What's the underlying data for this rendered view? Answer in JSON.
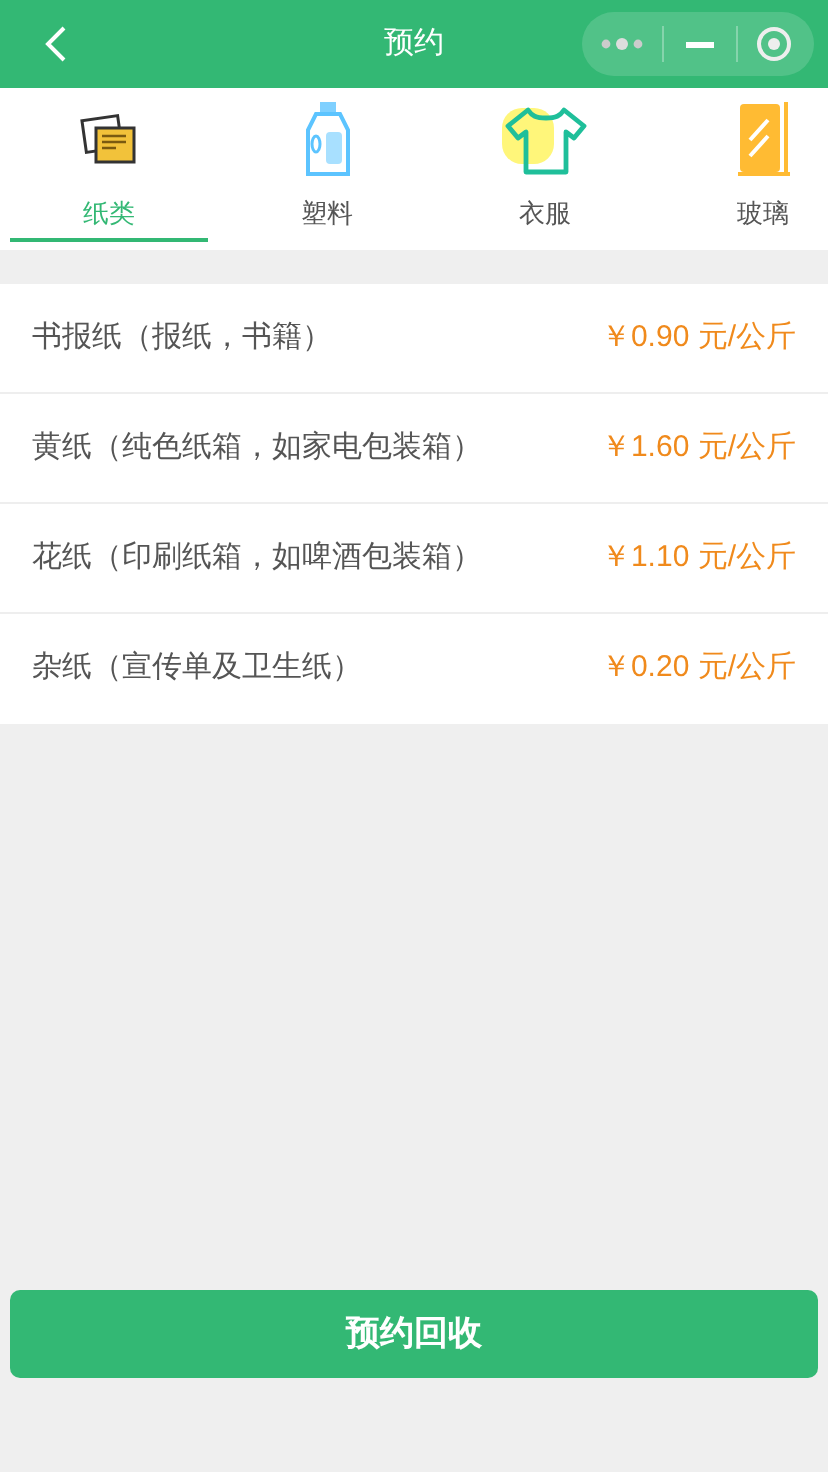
{
  "nav_bar": {
    "title": "预约"
  },
  "tabs": [
    {
      "label": "纸类",
      "kind": "paper",
      "selected": true
    },
    {
      "label": "塑料",
      "kind": "bottle",
      "selected": false
    },
    {
      "label": "衣服",
      "kind": "shirt",
      "selected": false
    },
    {
      "label": "玻璃",
      "kind": "glass",
      "selected": false
    }
  ],
  "prices": [
    {
      "name": "书报纸（报纸，书籍）",
      "price": "￥0.90 元/公斤"
    },
    {
      "name": "黄纸（纯色纸箱，如家电包装箱）",
      "price": "￥1.60 元/公斤"
    },
    {
      "name": "花纸（印刷纸箱，如啤酒包装箱）",
      "price": "￥1.10 元/公斤"
    },
    {
      "name": "杂纸（宣传单及卫生纸）",
      "price": "￥0.20 元/公斤"
    }
  ],
  "submit_button": "预约回收"
}
